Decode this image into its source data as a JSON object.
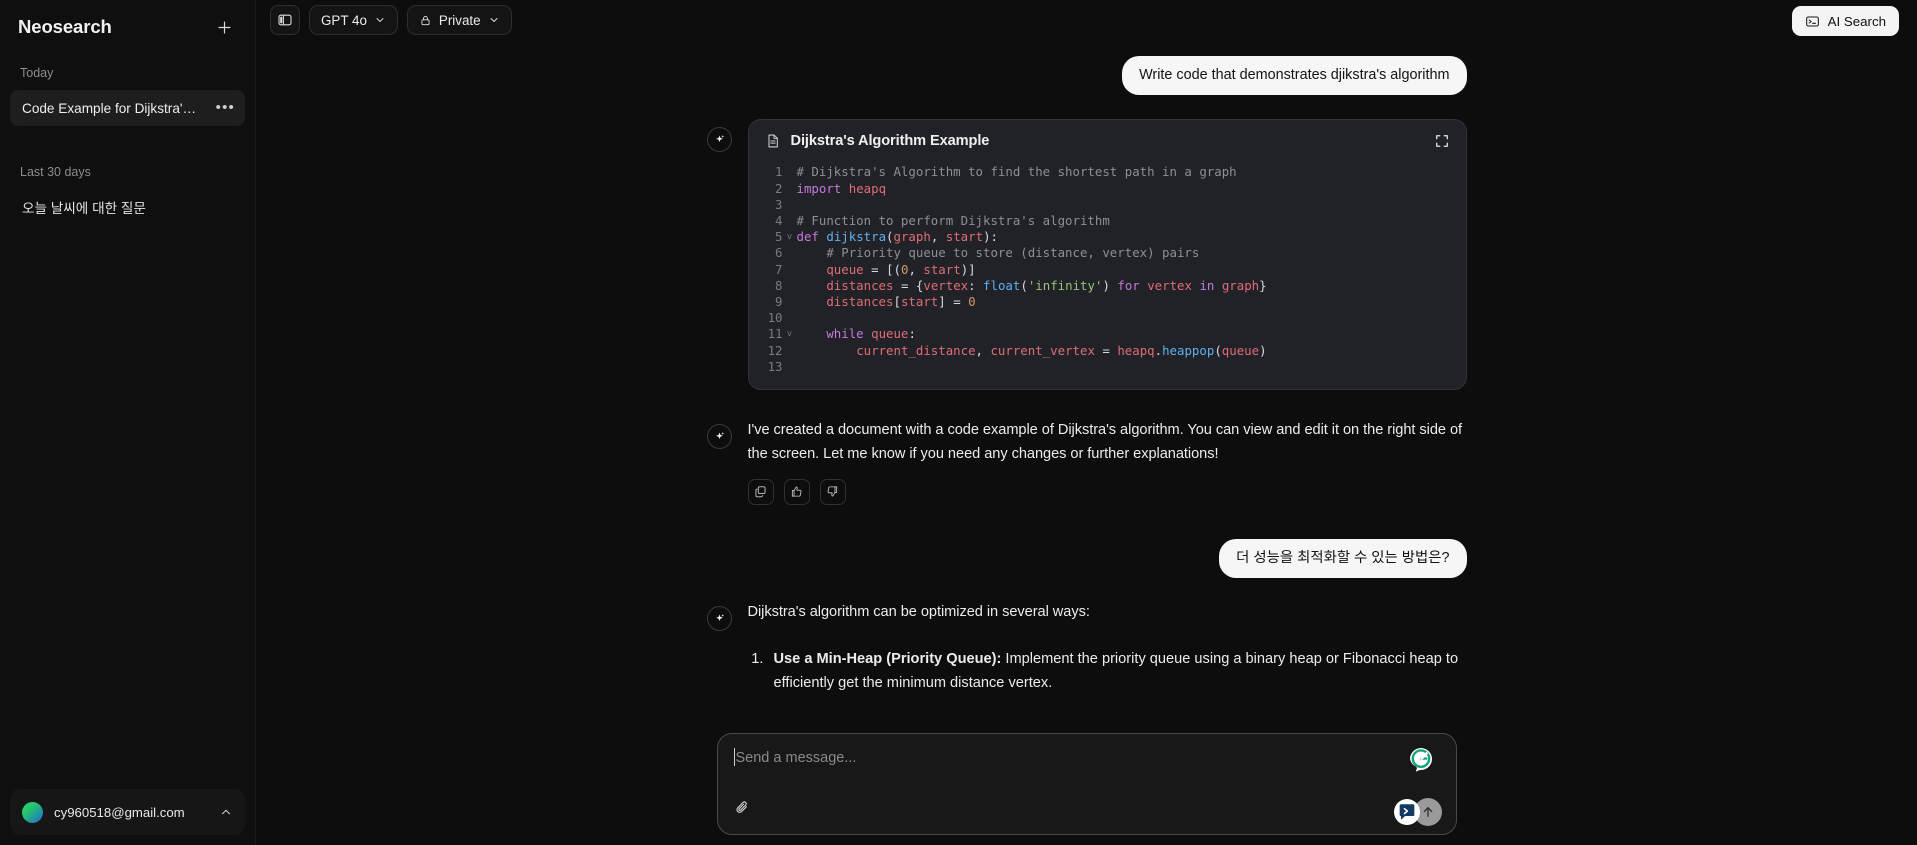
{
  "sidebar": {
    "title": "Neosearch",
    "new_chat_icon": "plus-icon",
    "groups": [
      {
        "label": "Today",
        "items": [
          {
            "label": "Code Example for Dijkstra's ...",
            "active": true,
            "menu": "•••"
          }
        ]
      },
      {
        "label": "Last 30 days",
        "items": [
          {
            "label": "오늘 날씨에 대한 질문",
            "active": false
          }
        ]
      }
    ],
    "account": {
      "email": "cy960518@gmail.com",
      "chevron": "chevron-up-icon"
    }
  },
  "topbar": {
    "sidebar_toggle_icon": "panel-toggle-icon",
    "model": {
      "label": "GPT 4o",
      "chevron": "chevron-down-icon"
    },
    "privacy": {
      "label": "Private",
      "icon": "lock-icon",
      "chevron": "chevron-down-icon"
    },
    "ai_search": {
      "label": "AI Search",
      "icon": "terminal-icon"
    }
  },
  "chat": {
    "user_message_1": "Write code that demonstrates djikstra's algorithm",
    "code_card": {
      "icon": "document-icon",
      "title": "Dijkstra's Algorithm Example",
      "expand_icon": "expand-icon",
      "lines": [
        {
          "n": "1",
          "fold": ""
        },
        {
          "n": "2",
          "fold": ""
        },
        {
          "n": "3",
          "fold": ""
        },
        {
          "n": "4",
          "fold": ""
        },
        {
          "n": "5",
          "fold": "v"
        },
        {
          "n": "6",
          "fold": ""
        },
        {
          "n": "7",
          "fold": ""
        },
        {
          "n": "8",
          "fold": ""
        },
        {
          "n": "9",
          "fold": ""
        },
        {
          "n": "10",
          "fold": ""
        },
        {
          "n": "11",
          "fold": "v"
        },
        {
          "n": "12",
          "fold": ""
        },
        {
          "n": "13",
          "fold": ""
        }
      ],
      "code_plain": [
        "# Dijkstra's Algorithm to find the shortest path in a graph",
        "import heapq",
        "",
        "# Function to perform Dijkstra's algorithm",
        "def dijkstra(graph, start):",
        "    # Priority queue to store (distance, vertex) pairs",
        "    queue = [(0, start)]",
        "    distances = {vertex: float('infinity') for vertex in graph}",
        "    distances[start] = 0",
        "",
        "    while queue:",
        "        current_distance, current_vertex = heapq.heappop(queue)",
        ""
      ]
    },
    "ai_message_1": "I've created a document with a code example of Dijkstra's algorithm. You can view and edit it on the right side of the screen. Let me know if you need any changes or further explanations!",
    "actions": [
      {
        "name": "copy",
        "icon": "copy-icon"
      },
      {
        "name": "like",
        "icon": "thumbs-up-icon"
      },
      {
        "name": "dislike",
        "icon": "thumbs-down-icon"
      }
    ],
    "user_message_2": "더 성능을 최적화할 수 있는 방법은?",
    "ai_message_2_intro": "Dijkstra's algorithm can be optimized in several ways:",
    "ai_message_2_list": [
      {
        "bold": "Use a Min-Heap (Priority Queue):",
        "rest": " Implement the priority queue using a binary heap or Fibonacci heap to efficiently get the minimum distance vertex."
      }
    ]
  },
  "composer": {
    "placeholder": "Send a message...",
    "attach_icon": "paperclip-icon",
    "grammarly_icon": "grammarly-g-icon",
    "assistant_badge_icon": "chat-bubble-icon",
    "send_icon": "arrow-up-icon"
  },
  "colors": {
    "page_bg": "#0d0d0d",
    "sidebar_bg": "#0f0f0f",
    "code_bg": "#202227",
    "accent_white": "#f4f4f4",
    "grammarly_green": "#15a37f",
    "badge_blue": "#123a63"
  }
}
